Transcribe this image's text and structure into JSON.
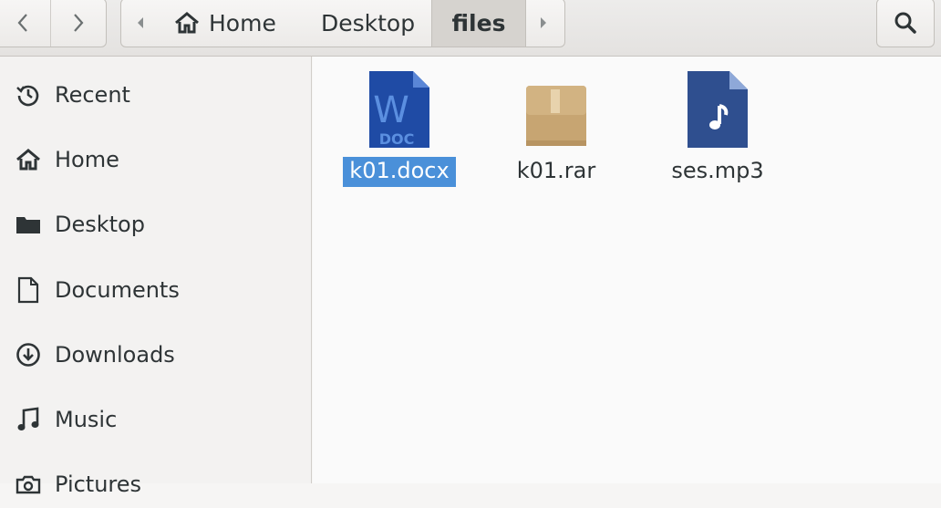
{
  "nav": {
    "back_icon": "chevron-left-icon",
    "forward_icon": "chevron-right-icon"
  },
  "pathbar": {
    "scroll_left_icon": "triangle-left-icon",
    "scroll_right_icon": "triangle-right-icon",
    "crumbs": [
      "Home",
      "Desktop",
      "files"
    ],
    "current": "files"
  },
  "search": {
    "icon": "search-icon"
  },
  "sidebar": {
    "items": [
      {
        "label": "Recent",
        "icon": "clock-icon"
      },
      {
        "label": "Home",
        "icon": "home-icon"
      },
      {
        "label": "Desktop",
        "icon": "folder-icon"
      },
      {
        "label": "Documents",
        "icon": "document-icon"
      },
      {
        "label": "Downloads",
        "icon": "download-icon"
      },
      {
        "label": "Music",
        "icon": "music-note-icon"
      },
      {
        "label": "Pictures",
        "icon": "camera-icon"
      }
    ]
  },
  "files": [
    {
      "name": "k01.docx",
      "icon": "word-document-icon",
      "icon_text": "W",
      "icon_badge": "DOC",
      "selected": true
    },
    {
      "name": "k01.rar",
      "icon": "archive-box-icon",
      "selected": false
    },
    {
      "name": "ses.mp3",
      "icon": "audio-file-icon",
      "selected": false
    }
  ],
  "colors": {
    "selection": "#4a90d9",
    "word_icon": "#1f4ba5",
    "archive_icon": "#c7a572",
    "audio_icon": "#2f4f8f"
  }
}
